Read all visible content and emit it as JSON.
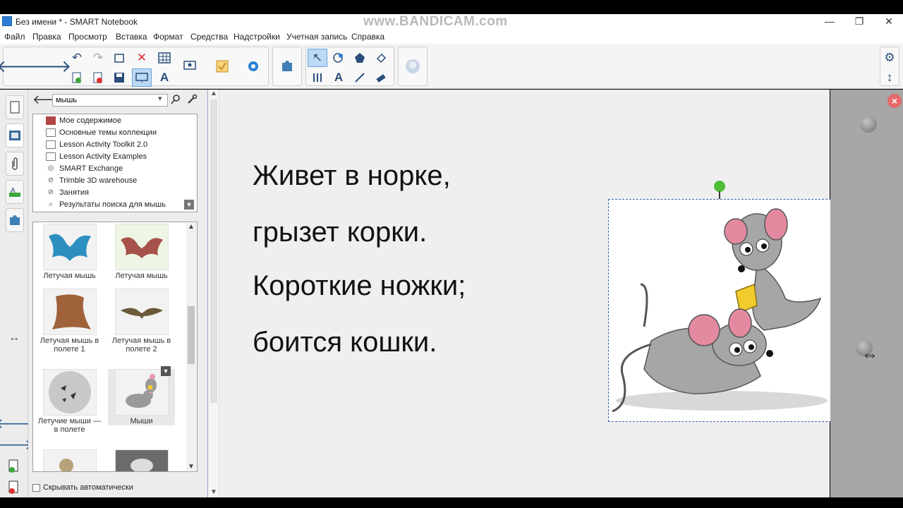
{
  "window": {
    "title": "Без имени * - SMART Notebook",
    "watermark": "www.BANDICAM.com",
    "minimize": "—",
    "restore": "❐",
    "close": "✕"
  },
  "menu": [
    "Файл",
    "Правка",
    "Просмотр",
    "Вставка",
    "Формат",
    "Средства",
    "Надстройки",
    "Учетная запись",
    "Справка"
  ],
  "toolbar": {
    "back_icon": "🡐",
    "forward_icon": "🡒",
    "undo_icon": "↶",
    "redo_icon": "↷",
    "delete_icon": "✕",
    "text_tool_icon": "A",
    "select_icon": "↖",
    "settings_icon": "⚙",
    "move_toolbar_icon": "↕"
  },
  "gallery": {
    "search_value": "мышь",
    "tree": [
      "Мое содержимое",
      "Основные темы коллекции",
      "Lesson Activity Toolkit 2.0",
      "Lesson Activity Examples",
      "SMART Exchange",
      "Trimble 3D warehouse",
      "Занятия",
      "Результаты поиска для мышь"
    ],
    "thumbs": [
      {
        "caption": "Летучая мышь"
      },
      {
        "caption": "Летучая мышь"
      },
      {
        "caption": "Летучая мышь в полете 1"
      },
      {
        "caption": "Летучая мышь в полете 2"
      },
      {
        "caption": "Летучие мыши — в полете"
      },
      {
        "caption": "Мыши"
      }
    ],
    "autohide_label": "Скрывать автоматически"
  },
  "slide": {
    "lines": [
      "Живет в норке,",
      "грызет корки.",
      "Короткие ножки;",
      "боится кошки."
    ]
  },
  "colors": {
    "accent": "#3d5fb0",
    "rotate_handle": "#4bbf37",
    "close_pane": "#e66a6a"
  }
}
